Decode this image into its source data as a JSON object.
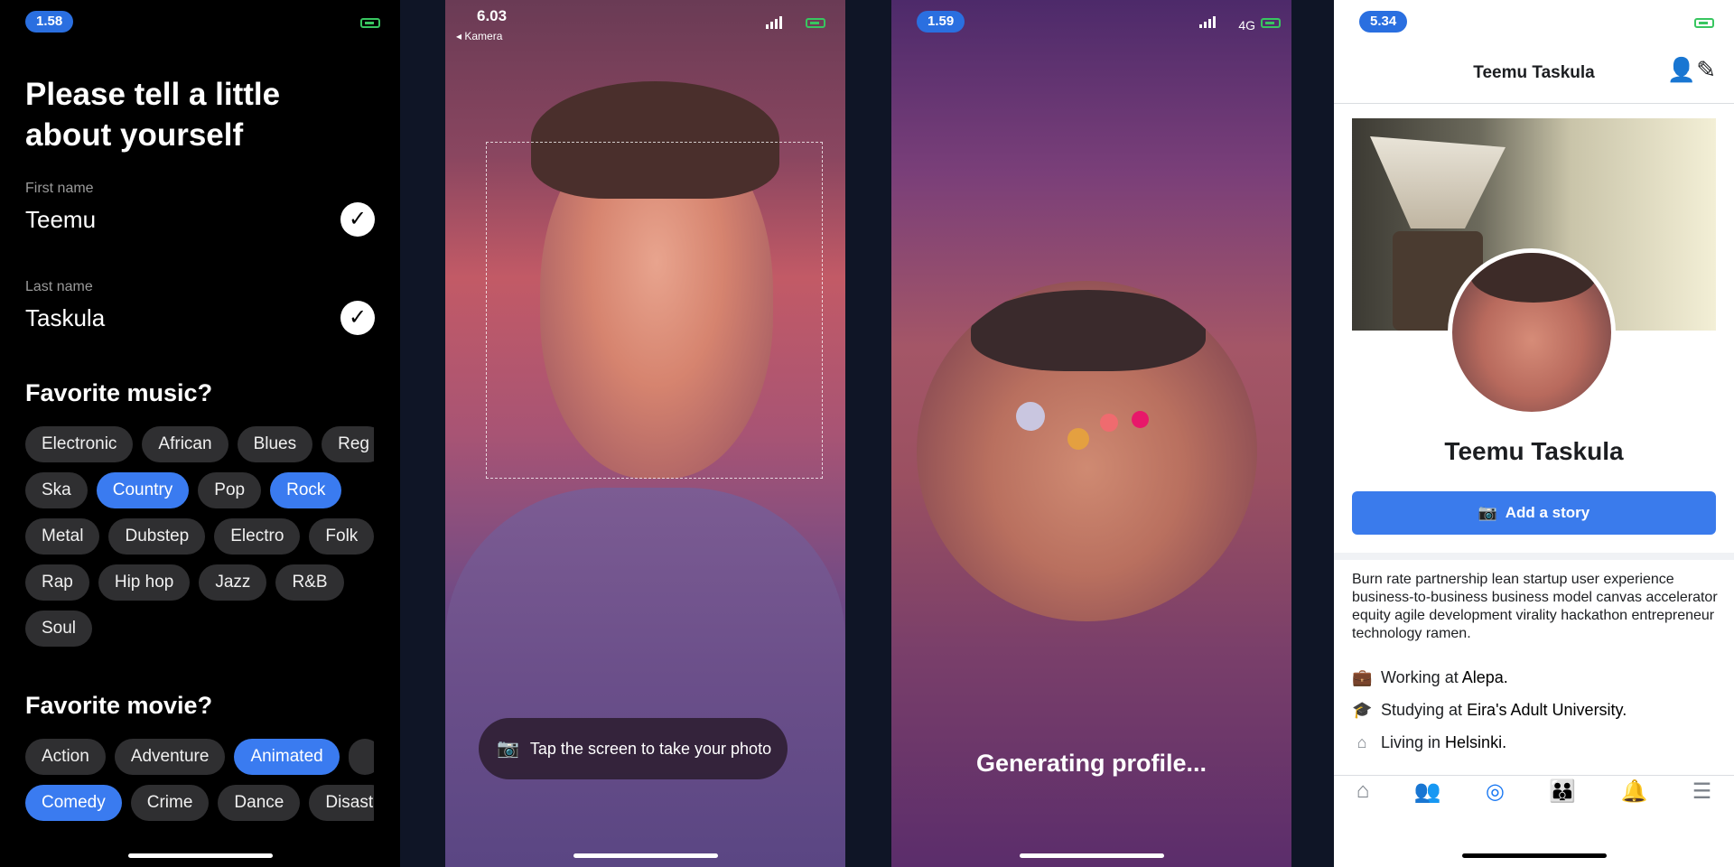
{
  "screen1": {
    "time": "1.58",
    "title": "Please tell a little about yourself",
    "first_name_label": "First name",
    "first_name": "Teemu",
    "last_name_label": "Last name",
    "last_name": "Taskula",
    "check_glyph": "✓",
    "music_title": "Favorite music?",
    "music_rows": [
      [
        {
          "label": "Electronic",
          "selected": false
        },
        {
          "label": "African",
          "selected": false
        },
        {
          "label": "Blues",
          "selected": false
        },
        {
          "label": "Reg",
          "selected": false
        }
      ],
      [
        {
          "label": "Ska",
          "selected": false
        },
        {
          "label": "Country",
          "selected": true
        },
        {
          "label": "Pop",
          "selected": false
        },
        {
          "label": "Rock",
          "selected": true
        }
      ],
      [
        {
          "label": "Metal",
          "selected": false
        },
        {
          "label": "Dubstep",
          "selected": false
        },
        {
          "label": "Electro",
          "selected": false
        },
        {
          "label": "Folk",
          "selected": false
        }
      ],
      [
        {
          "label": "Rap",
          "selected": false
        },
        {
          "label": "Hip hop",
          "selected": false
        },
        {
          "label": "Jazz",
          "selected": false
        },
        {
          "label": "R&B",
          "selected": false
        }
      ],
      [
        {
          "label": "Soul",
          "selected": false
        }
      ]
    ],
    "movie_title": "Favorite movie?",
    "movie_rows": [
      [
        {
          "label": "Action",
          "selected": false
        },
        {
          "label": "Adventure",
          "selected": false
        },
        {
          "label": "Animated",
          "selected": true
        },
        {
          "label": "",
          "selected": false
        }
      ],
      [
        {
          "label": "Comedy",
          "selected": true
        },
        {
          "label": "Crime",
          "selected": false
        },
        {
          "label": "Dance",
          "selected": false
        },
        {
          "label": "Disast",
          "selected": false
        }
      ]
    ]
  },
  "screen2": {
    "time": "6.03",
    "back_label": "◂ Kamera",
    "tip": "Tap the screen to take your photo",
    "camera_icon": "camera-icon"
  },
  "screen3": {
    "time": "1.59",
    "network": "4G",
    "status": "Generating profile...",
    "dot_colors": [
      "#c9c6e0",
      "#e4a040",
      "#ef6b6f",
      "#e8186a"
    ]
  },
  "screen4": {
    "time": "5.34",
    "header_name": "Teemu  Taskula",
    "profile_name": "Teemu  Taskula",
    "story_button": "Add a story",
    "bio": "Burn rate partnership lean startup user experience business-to-business business model canvas accelerator equity agile development virality hackathon entrepreneur technology ramen.",
    "work_prefix": "Working at ",
    "work_place": "Alepa.",
    "study_prefix": "Studying at ",
    "study_place": "Eira's Adult University.",
    "home_prefix": "Living in ",
    "home_place": "Helsinki.",
    "accent": "#3a7bec",
    "tabs": [
      "home-icon",
      "friends-icon",
      "profile-icon",
      "groups-icon",
      "bell-icon",
      "menu-icon"
    ]
  }
}
